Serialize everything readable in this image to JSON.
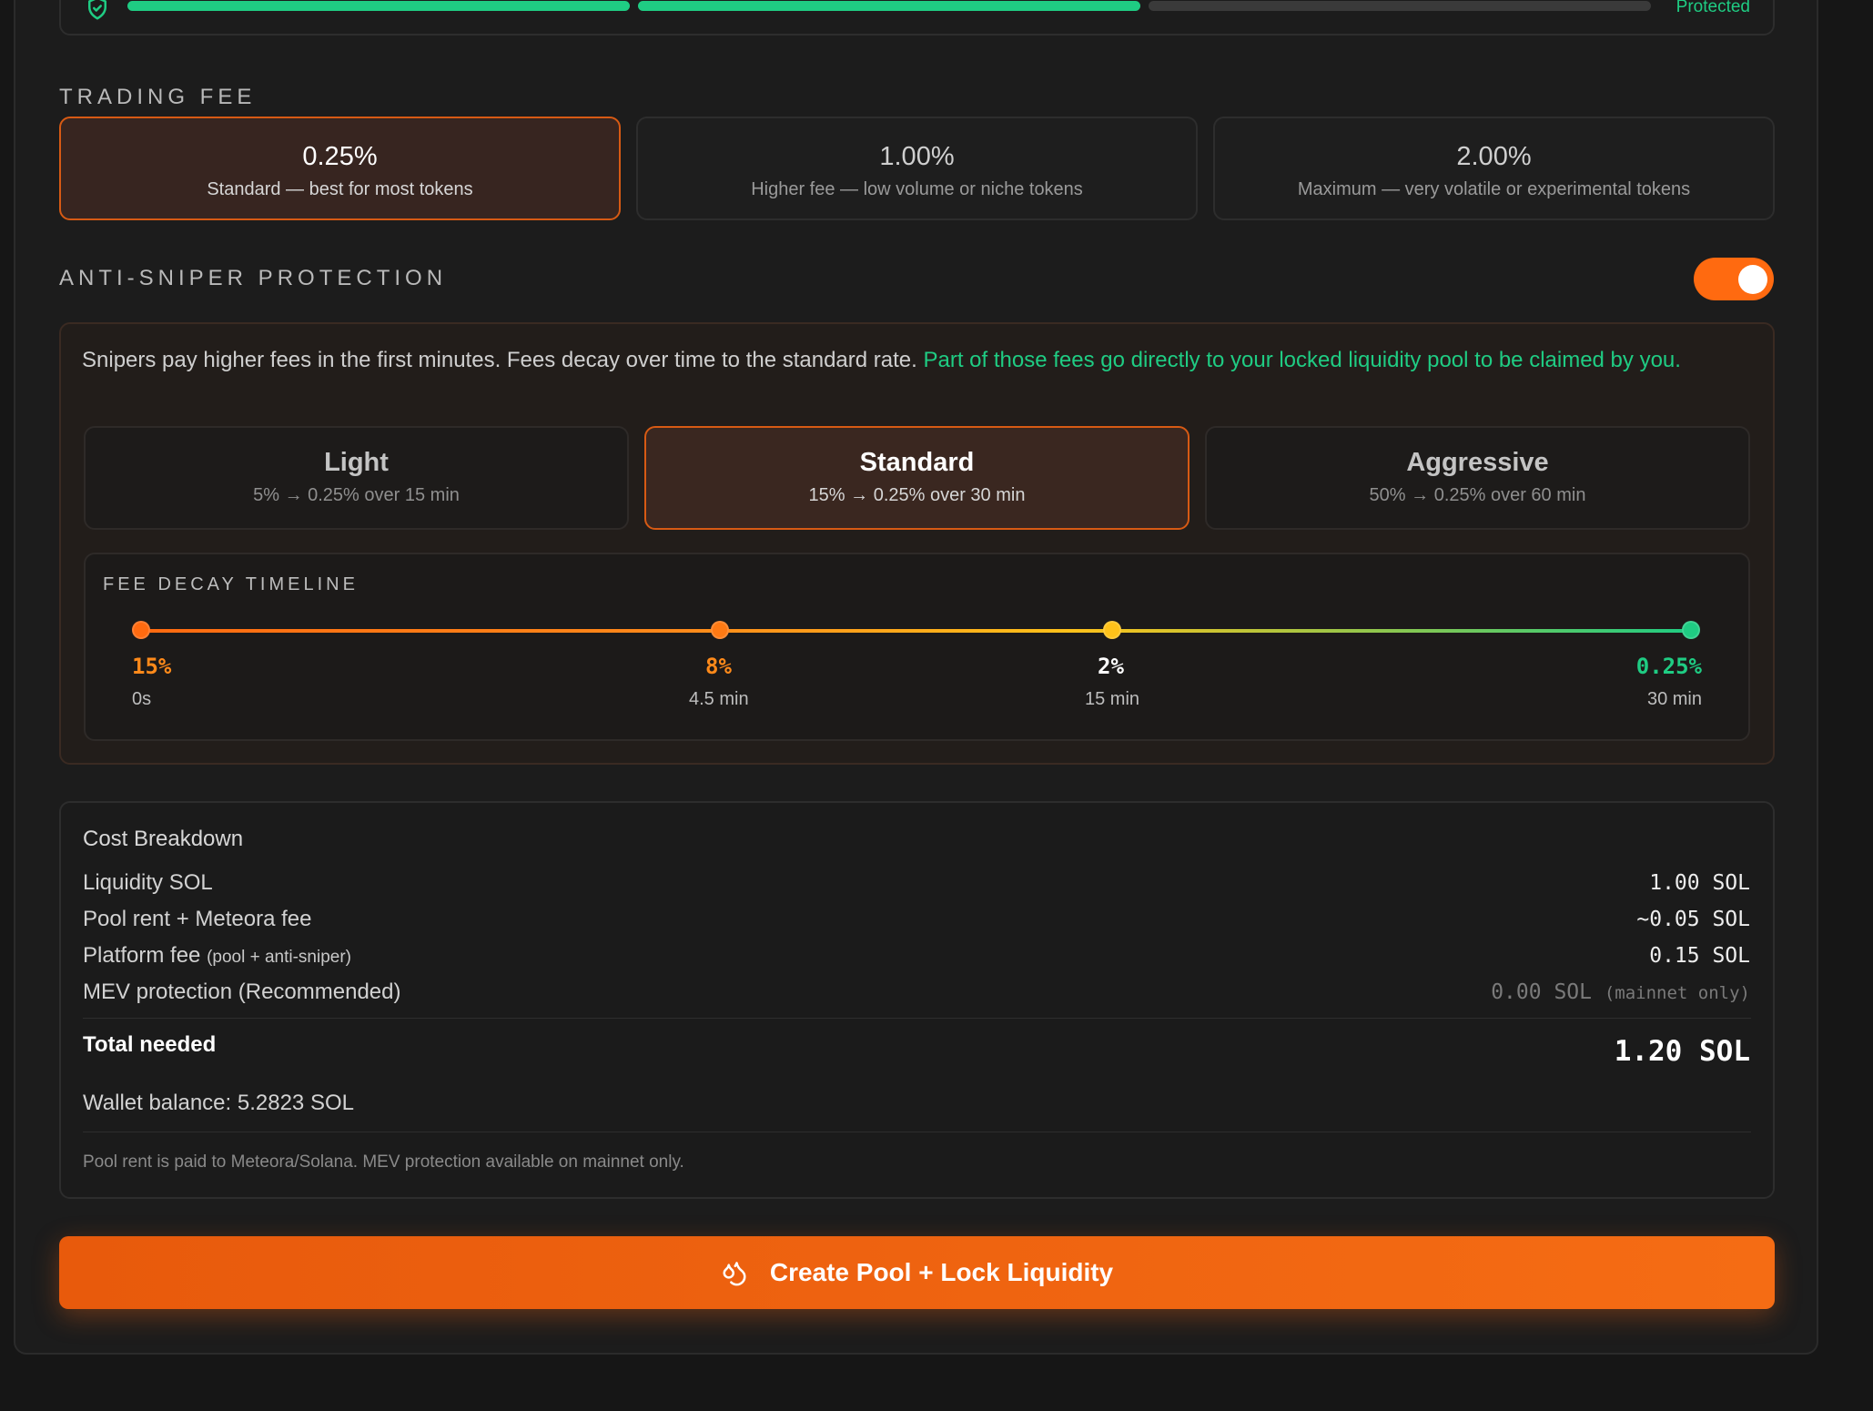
{
  "colors": {
    "accent": "#ff6a10",
    "green": "#1fcc83",
    "yellow": "#ffc21a"
  },
  "security": {
    "status": "Protected",
    "icon": "shield-check-icon"
  },
  "trading_fee": {
    "label": "TRADING FEE",
    "options": [
      {
        "pct": "0.25%",
        "desc": "Standard — best for most tokens",
        "selected": true
      },
      {
        "pct": "1.00%",
        "desc": "Higher fee — low volume or niche tokens",
        "selected": false
      },
      {
        "pct": "2.00%",
        "desc": "Maximum — very volatile or experimental tokens",
        "selected": false
      }
    ]
  },
  "anti_sniper": {
    "label": "ANTI-SNIPER PROTECTION",
    "enabled": true,
    "info": "Snipers pay higher fees in the first minutes. Fees decay over time to the standard rate.",
    "info_highlight": "Part of those fees go directly to your locked liquidity pool to be claimed by you.",
    "presets": [
      {
        "name": "Light",
        "sub": "5% → 0.25% over 15 min",
        "selected": false
      },
      {
        "name": "Standard",
        "sub": "15% → 0.25% over 30 min",
        "selected": true
      },
      {
        "name": "Aggressive",
        "sub": "50% → 0.25% over 60 min",
        "selected": false
      }
    ],
    "timeline": {
      "label": "FEE DECAY TIMELINE",
      "points": [
        {
          "value": "15%",
          "time": "0s"
        },
        {
          "value": "8%",
          "time": "4.5 min"
        },
        {
          "value": "2%",
          "time": "15 min"
        },
        {
          "value": "0.25%",
          "time": "30 min"
        }
      ]
    }
  },
  "cost": {
    "title": "Cost Breakdown",
    "rows": [
      {
        "label": "Liquidity SOL",
        "value": "1.00 SOL"
      },
      {
        "label": "Pool rent + Meteora fee",
        "value": "~0.05 SOL"
      },
      {
        "label": "Platform fee",
        "label_note": "(pool + anti-sniper)",
        "value": "0.15 SOL"
      },
      {
        "label": "MEV protection (Recommended)",
        "value": "0.00 SOL",
        "value_note": "(mainnet only)"
      }
    ],
    "total_label": "Total needed",
    "total_value": "1.20 SOL",
    "wallet": "Wallet balance: 5.2823 SOL",
    "footnote": "Pool rent is paid to Meteora/Solana. MEV protection available on mainnet only."
  },
  "create_button": {
    "label": "Create Pool + Lock Liquidity",
    "icon": "droplets-icon"
  }
}
